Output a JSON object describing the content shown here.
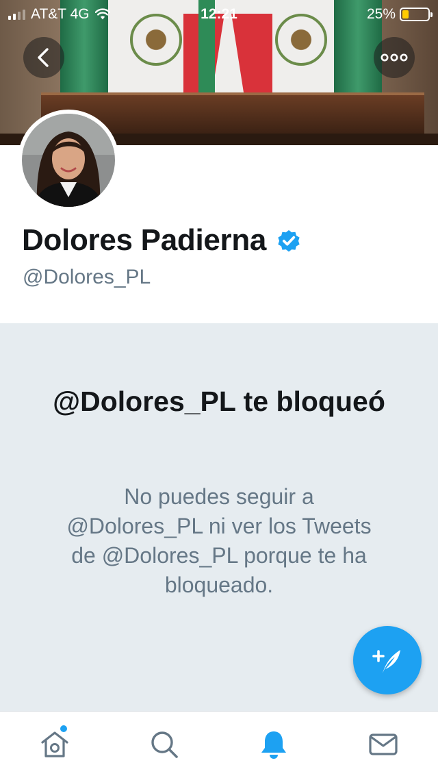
{
  "status_bar": {
    "carrier": "AT&T 4G",
    "time": "12:21",
    "battery": "25%",
    "battery_level": 0.25
  },
  "profile": {
    "name": "Dolores Padierna",
    "handle": "@Dolores_PL",
    "verified": true
  },
  "blocked": {
    "title": "@Dolores_PL te bloqueó",
    "message": "No puedes seguir a @Dolores_PL ni ver los Tweets de @Dolores_PL porque te ha bloqueado."
  },
  "icons": {
    "back": "chevron-left-icon",
    "more": "more-icon",
    "compose": "compose-tweet-icon",
    "home": "home-icon",
    "search": "search-icon",
    "notifications": "bell-icon",
    "messages": "mail-icon"
  },
  "colors": {
    "accent": "#1da1f2",
    "panel_bg": "#e6ecf0",
    "primary_text": "#14171a",
    "secondary_text": "#657786"
  },
  "tabs": {
    "active": "notifications",
    "home_has_badge": true
  }
}
